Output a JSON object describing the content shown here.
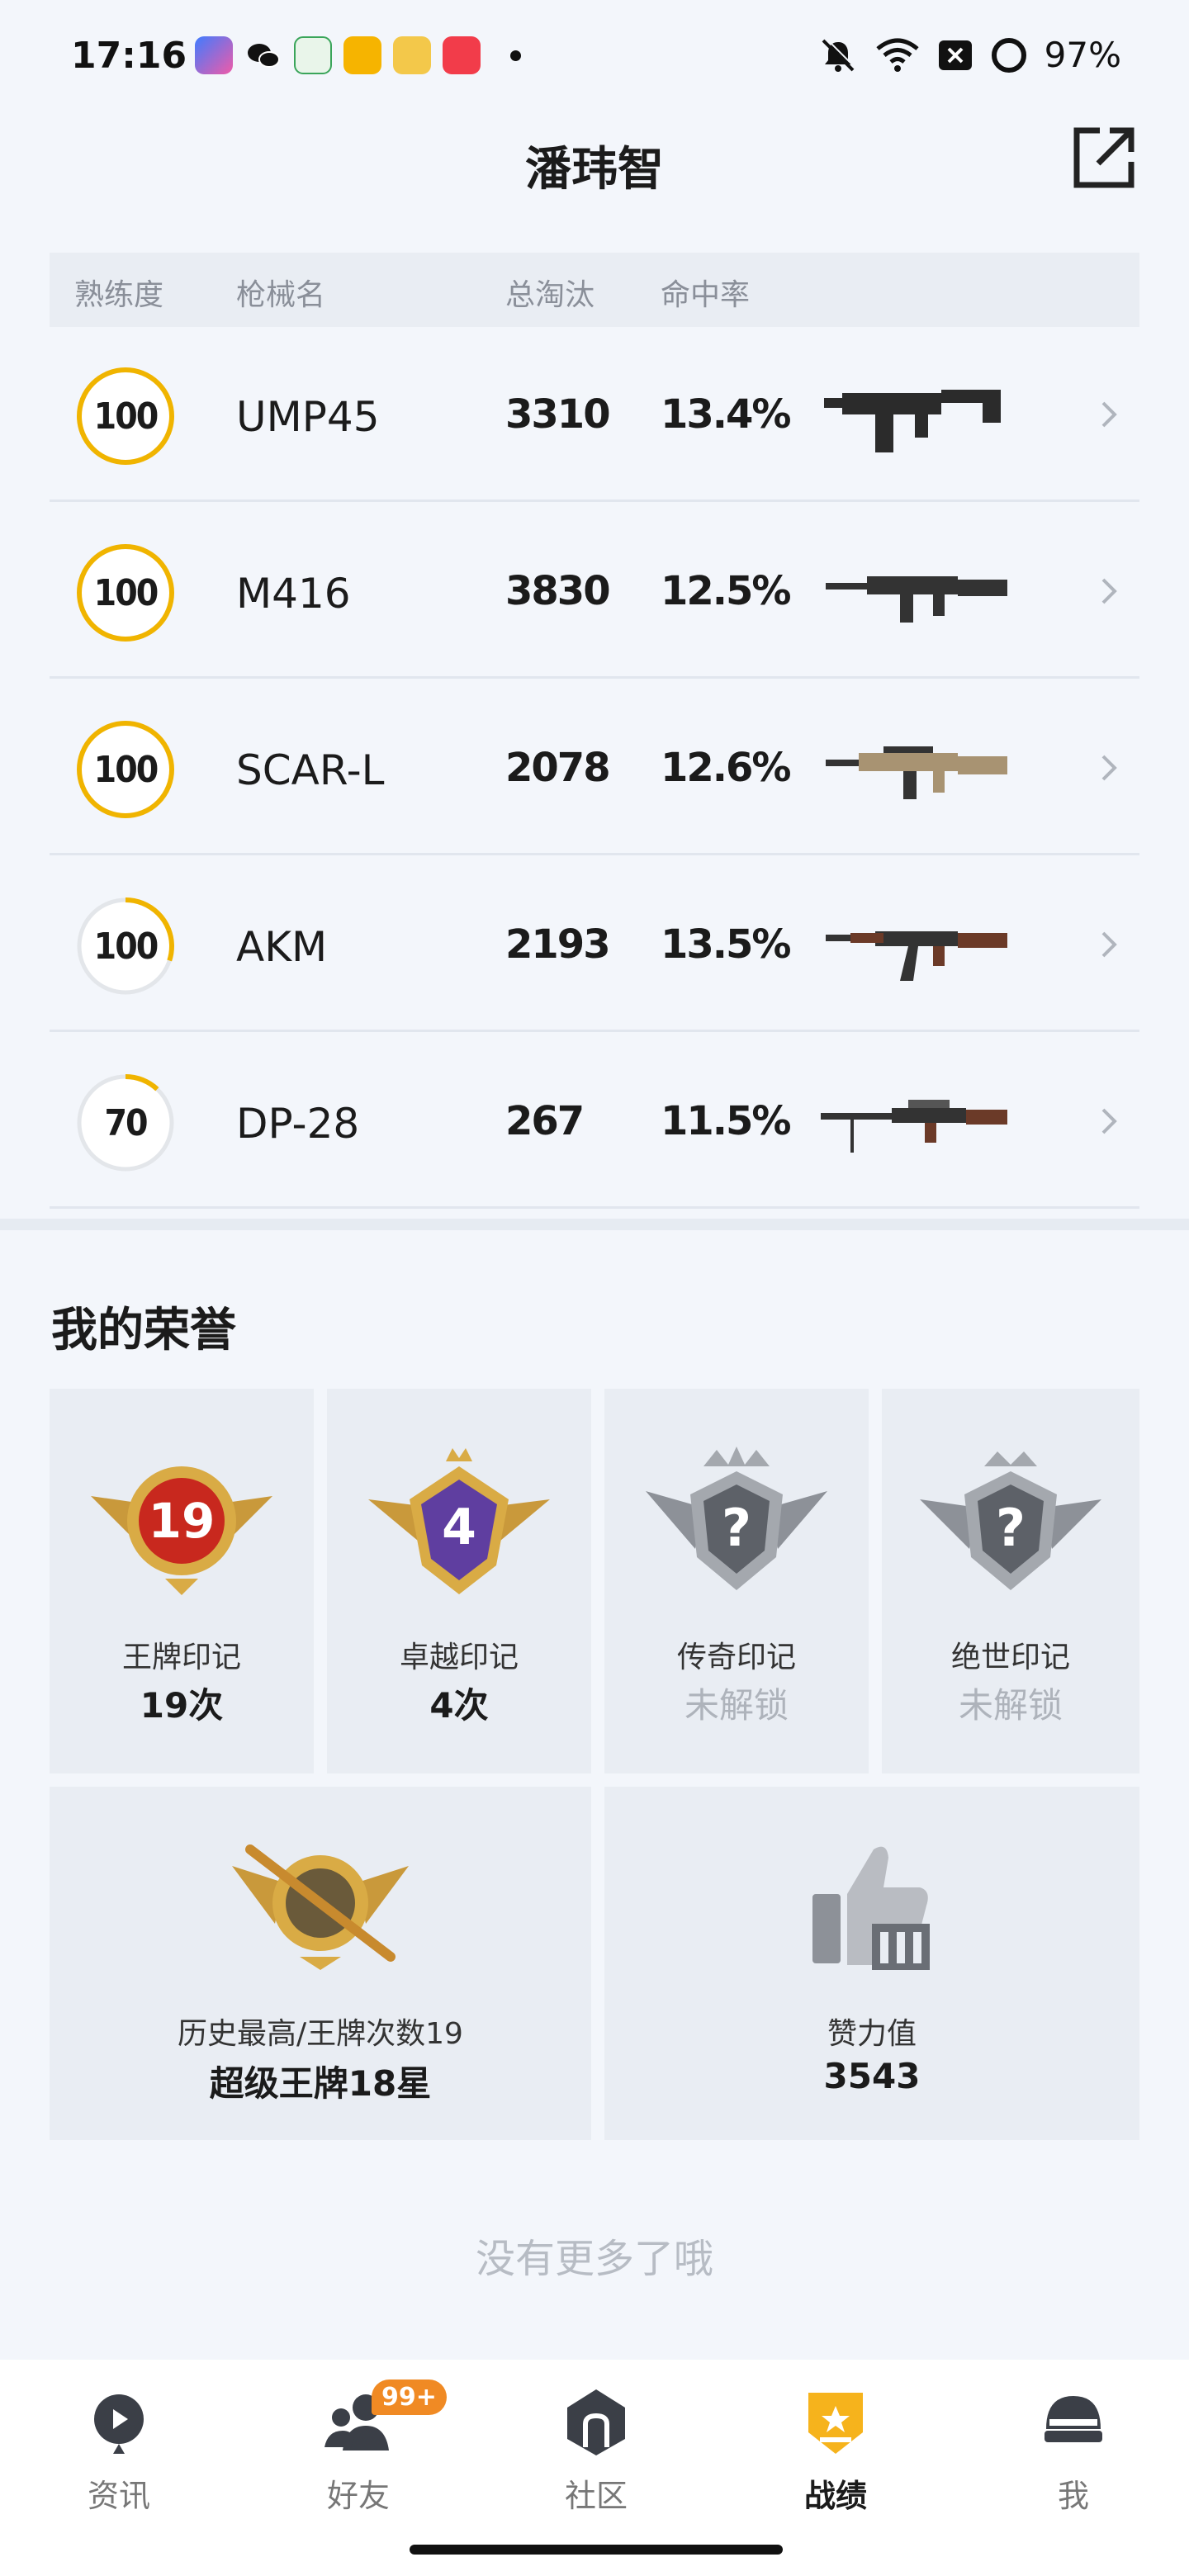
{
  "status_bar": {
    "time": "17:16",
    "battery": "97%",
    "app_icons": [
      "game-app-icon",
      "wechat-icon",
      "oppo-app-icon",
      "music-app-icon",
      "news-app-icon",
      "music-red-app-icon"
    ],
    "icons": [
      "mute-bell-icon",
      "wifi-icon",
      "close-box-icon",
      "battery-ring-icon"
    ]
  },
  "header": {
    "title": "潘玮智",
    "share_icon": "share-external-icon"
  },
  "weapons_table": {
    "headers": [
      "熟练度",
      "枪械名",
      "总淘汰",
      "命中率"
    ],
    "rows": [
      {
        "proficiency": "100",
        "proficiency_fill": 1.0,
        "name": "UMP45",
        "kills": "3310",
        "hit_rate": "13.4%",
        "gun": "smg"
      },
      {
        "proficiency": "100",
        "proficiency_fill": 1.0,
        "name": "M416",
        "kills": "3830",
        "hit_rate": "12.5%",
        "gun": "rifle-black"
      },
      {
        "proficiency": "100",
        "proficiency_fill": 1.0,
        "name": "SCAR-L",
        "kills": "2078",
        "hit_rate": "12.6%",
        "gun": "rifle-tan"
      },
      {
        "proficiency": "100",
        "proficiency_fill": 0.3,
        "name": "AKM",
        "kills": "2193",
        "hit_rate": "13.5%",
        "gun": "akm"
      },
      {
        "proficiency": "70",
        "proficiency_fill": 0.12,
        "name": "DP-28",
        "kills": "267",
        "hit_rate": "11.5%",
        "gun": "lmg"
      }
    ]
  },
  "honor": {
    "title": "我的荣誉",
    "marks": [
      {
        "label": "王牌印记",
        "value": "19次",
        "medal_text": "19",
        "locked": false
      },
      {
        "label": "卓越印记",
        "value": "4次",
        "medal_text": "4",
        "locked": false
      },
      {
        "label": "传奇印记",
        "value": "未解锁",
        "medal_text": "?",
        "locked": true
      },
      {
        "label": "绝世印记",
        "value": "未解锁",
        "medal_text": "?",
        "locked": true
      }
    ],
    "highest": {
      "label": "历史最高/王牌次数19",
      "value": "超级王牌18星"
    },
    "likes": {
      "label": "赞力值",
      "value": "3543"
    }
  },
  "footer_text": "没有更多了哦",
  "bottom_nav": {
    "items": [
      {
        "label": "资讯",
        "icon": "news-play-icon"
      },
      {
        "label": "好友",
        "icon": "friends-icon",
        "badge": "99+"
      },
      {
        "label": "社区",
        "icon": "community-icon"
      },
      {
        "label": "战绩",
        "icon": "record-badge-icon",
        "active": true
      },
      {
        "label": "我",
        "icon": "helmet-icon"
      }
    ]
  },
  "colors": {
    "accent": "#f0b400",
    "ring_track": "#e3e6ea",
    "badge": "#f08a24"
  }
}
